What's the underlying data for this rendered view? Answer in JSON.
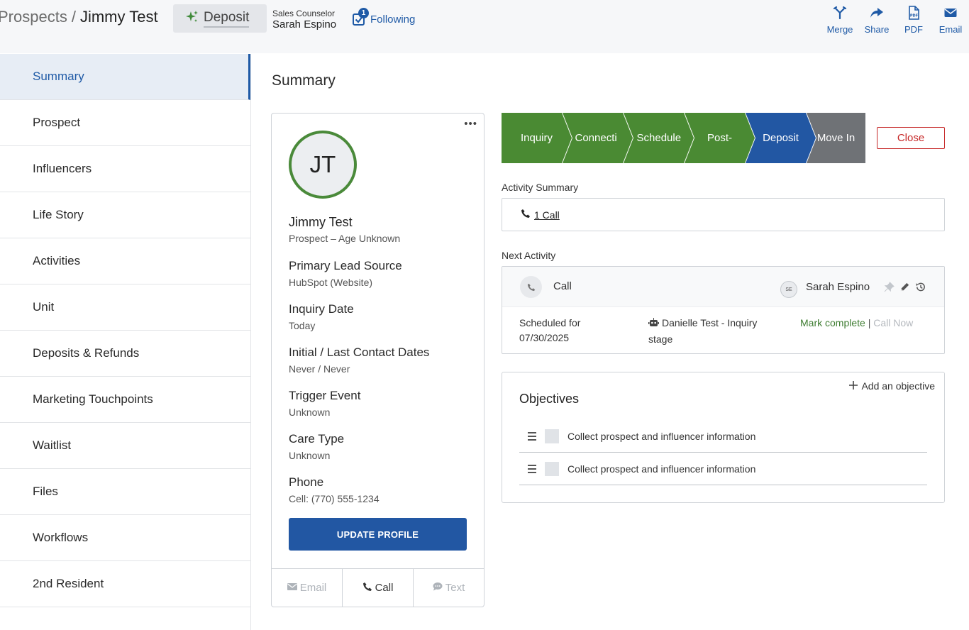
{
  "header": {
    "breadcrumb_root": "Prospects",
    "breadcrumb_sep": "/",
    "breadcrumb_name": "Jimmy Test",
    "stage_chip": "Deposit",
    "counselor_title": "Sales Counselor",
    "counselor_name": "Sarah Espino",
    "following_label": "Following",
    "following_count": "1",
    "actions": [
      {
        "label": "Merge",
        "icon": "merge-icon"
      },
      {
        "label": "Share",
        "icon": "share-icon"
      },
      {
        "label": "PDF",
        "icon": "pdf-icon"
      },
      {
        "label": "Email",
        "icon": "envelope-icon"
      }
    ]
  },
  "sidebar": {
    "items": [
      {
        "label": "Summary",
        "active": true
      },
      {
        "label": "Prospect"
      },
      {
        "label": "Influencers"
      },
      {
        "label": "Life Story"
      },
      {
        "label": "Activities"
      },
      {
        "label": "Unit"
      },
      {
        "label": "Deposits & Refunds"
      },
      {
        "label": "Marketing Touchpoints"
      },
      {
        "label": "Waitlist"
      },
      {
        "label": "Files"
      },
      {
        "label": "Workflows"
      },
      {
        "label": "2nd Resident"
      }
    ]
  },
  "main": {
    "title": "Summary",
    "profile": {
      "initials": "JT",
      "name": "Jimmy Test",
      "subtitle": "Prospect – Age Unknown",
      "fields": [
        {
          "label": "Primary Lead Source",
          "value": "HubSpot (Website)"
        },
        {
          "label": "Inquiry Date",
          "value": "Today"
        },
        {
          "label": "Initial / Last Contact Dates",
          "value": "Never / Never"
        },
        {
          "label": "Trigger Event",
          "value": "Unknown"
        },
        {
          "label": "Care Type",
          "value": "Unknown"
        },
        {
          "label": "Phone",
          "value": "Cell: (770) 555-1234"
        }
      ],
      "update_button": "UPDATE PROFILE",
      "contact_buttons": [
        {
          "label": "Email",
          "icon": "envelope-icon",
          "enabled": false
        },
        {
          "label": "Call",
          "icon": "phone-icon",
          "enabled": true
        },
        {
          "label": "Text",
          "icon": "chat-icon",
          "enabled": false
        }
      ]
    },
    "stages": [
      {
        "label": "Inquiry",
        "color": "#4a8a33"
      },
      {
        "label": "Connecti",
        "color": "#4a8a33"
      },
      {
        "label": "Schedule",
        "color": "#4a8a33"
      },
      {
        "label": "Post-",
        "color": "#4a8a33"
      },
      {
        "label": "Deposit",
        "color": "#2257a3"
      },
      {
        "label": "Move In",
        "color": "#6f7276"
      }
    ],
    "close_button": "Close",
    "activity_summary": {
      "label": "Activity Summary",
      "link": "1 Call"
    },
    "next_activity": {
      "label": "Next Activity",
      "type": "Call",
      "owner_initials": "SE",
      "owner": "Sarah Espino",
      "scheduled_label": "Scheduled for",
      "scheduled_date": "07/30/2025",
      "workflow": "Danielle Test - Inquiry stage",
      "mark_complete": "Mark complete",
      "separator": "|",
      "call_now": "Call Now"
    },
    "objectives": {
      "title": "Objectives",
      "add_label": "Add an objective",
      "items": [
        "Collect prospect and influencer information",
        "Collect prospect and influencer information"
      ]
    }
  }
}
